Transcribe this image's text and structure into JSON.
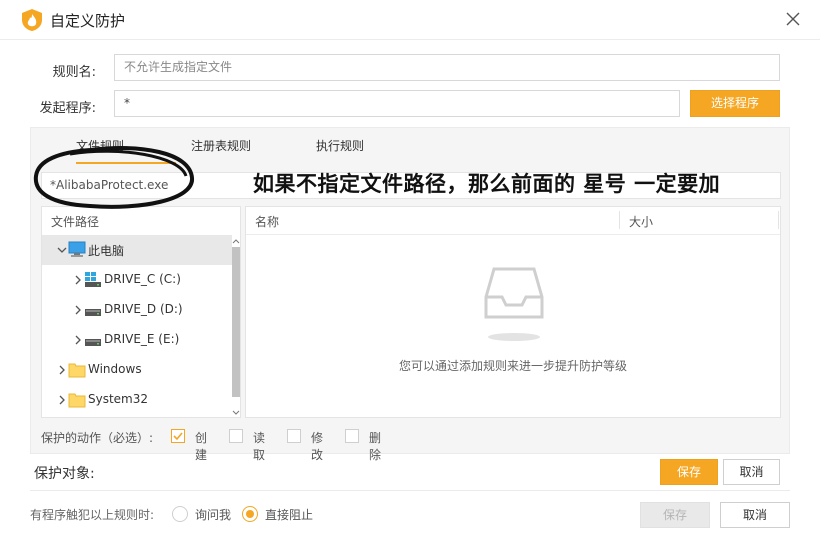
{
  "window": {
    "title": "自定义防护"
  },
  "form": {
    "rule_name_label": "规则名:",
    "rule_name_placeholder": "不允许生成指定文件",
    "process_label": "发起程序:",
    "process_value": "*",
    "select_program_button": "选择程序"
  },
  "tabs": [
    {
      "label": "文件规则",
      "active": true
    },
    {
      "label": "注册表规则",
      "active": false
    },
    {
      "label": "执行规则",
      "active": false
    }
  ],
  "path_value": "*AlibabaProtect.exe",
  "annotation": "如果不指定文件路径，那么前面的 星号 一定要加",
  "tree": {
    "header": "文件路径",
    "items": [
      {
        "label": "此电脑",
        "icon": "computer-icon"
      },
      {
        "label": "DRIVE_C (C:)",
        "icon": "windows-drive-icon"
      },
      {
        "label": "DRIVE_D (D:)",
        "icon": "drive-icon"
      },
      {
        "label": "DRIVE_E (E:)",
        "icon": "drive-icon"
      },
      {
        "label": "Windows",
        "icon": "folder-icon"
      },
      {
        "label": "System32",
        "icon": "folder-icon"
      }
    ]
  },
  "list": {
    "col_name": "名称",
    "col_size": "大小",
    "empty_text": "您可以通过添加规则来进一步提升防护等级"
  },
  "actions": {
    "label": "保护的动作（必选）:",
    "options": [
      {
        "label": "创建",
        "checked": true
      },
      {
        "label": "读取",
        "checked": false
      },
      {
        "label": "修改",
        "checked": false
      },
      {
        "label": "删除",
        "checked": false
      }
    ]
  },
  "protect_object": {
    "label": "保护对象:",
    "save": "保存",
    "cancel": "取消"
  },
  "footer": {
    "trigger_label": "有程序触犯以上规则时:",
    "options": [
      {
        "label": "询问我",
        "selected": false
      },
      {
        "label": "直接阻止",
        "selected": true
      }
    ],
    "save": "保存",
    "cancel": "取消"
  },
  "colors": {
    "accent": "#f5a623",
    "panel_bg": "#f5f5f5",
    "border": "#e4e4e4"
  }
}
